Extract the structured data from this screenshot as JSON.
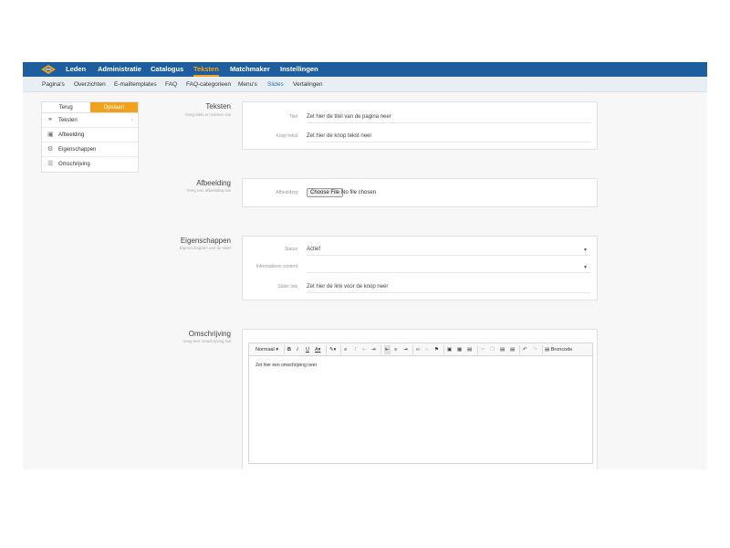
{
  "topnav": {
    "items": [
      "Leden",
      "Administratie",
      "Catalogus",
      "Teksten",
      "Matchmaker",
      "Instellingen"
    ],
    "active": "Teksten",
    "colors": {
      "bar": "#1e5d9e",
      "active": "#f0a21c"
    }
  },
  "subnav": {
    "items": [
      "Pagina's",
      "Overzichten",
      "E-mailtemplates",
      "FAQ",
      "FAQ-categorieen",
      "Menu's",
      "Slides",
      "Vertalingen"
    ],
    "active": "Slides"
  },
  "leftnav": {
    "tabs": [
      "Terug",
      "Opslaan"
    ],
    "items": [
      {
        "label": "Teksten",
        "icon": "tag-icon"
      },
      {
        "label": "Afbeelding",
        "icon": "image-icon"
      },
      {
        "label": "Eigenschappen",
        "icon": "settings-icon"
      },
      {
        "label": "Omschrijving",
        "icon": "list-icon"
      }
    ]
  },
  "sections": {
    "teksten": {
      "title": "Teksten",
      "subtitle": "Voeg titels en teksten toe",
      "fields": [
        {
          "label": "Titel",
          "value": "Zet hier de titel van de pagina neer"
        },
        {
          "label": "Knop tekst",
          "value": "Zet hier de knop tekst neer"
        }
      ]
    },
    "afbeelding": {
      "title": "Afbeelding",
      "subtitle": "Voeg een afbeelding toe",
      "label": "Afbeelding",
      "button": "Choose File",
      "file_status": "No file chosen"
    },
    "eigenschappen": {
      "title": "Eigenschappen",
      "subtitle": "Eigenschappen van de slide",
      "fields": [
        {
          "label": "Status",
          "value": "Actief"
        },
        {
          "label": "Informatieve content",
          "value": ""
        },
        {
          "label": "Slider link",
          "value": "Zet hier de link voor de knop neer"
        }
      ]
    },
    "omschrijving": {
      "title": "Omschrijving",
      "subtitle": "Voeg een omschrijving toe",
      "toolbar": {
        "format": "Normaal",
        "source": "Broncode"
      },
      "content": "Zet hier een omschrijving neer"
    }
  }
}
